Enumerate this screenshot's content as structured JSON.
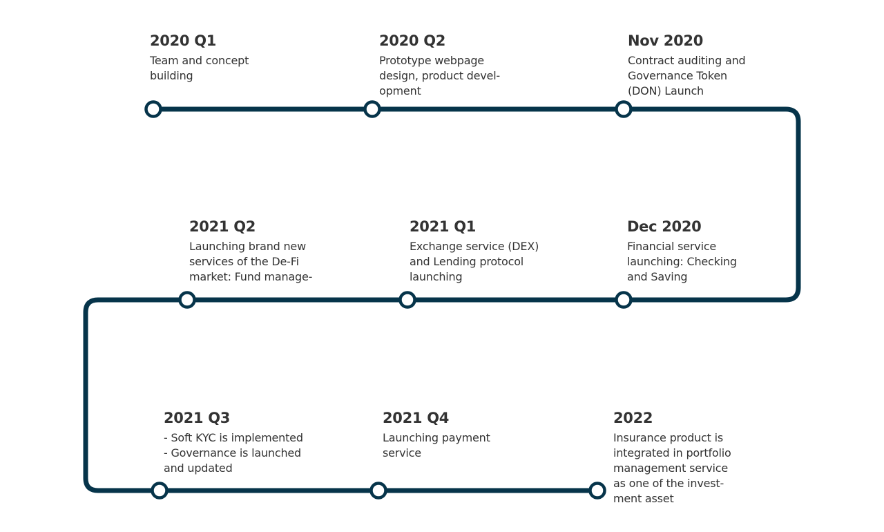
{
  "colors": {
    "track": "#06344a",
    "node_fill": "#ffffff",
    "text": "#333333"
  },
  "milestones": [
    {
      "title": "2020 Q1",
      "lines": [
        "Team and concept",
        "building"
      ]
    },
    {
      "title": "2020 Q2",
      "lines": [
        "Prototype webpage",
        "design, product devel-",
        "opment"
      ]
    },
    {
      "title": "Nov 2020",
      "lines": [
        "Contract auditing and",
        "Governance Token",
        "(DON) Launch"
      ]
    },
    {
      "title": "Dec 2020",
      "lines": [
        "Financial service",
        "launching: Checking",
        "and Saving"
      ]
    },
    {
      "title": "2021 Q1",
      "lines": [
        "Exchange service (DEX)",
        "and Lending protocol",
        "launching"
      ]
    },
    {
      "title": "2021 Q2",
      "lines": [
        "Launching brand new",
        "services of the De-Fi",
        "market: Fund manage-"
      ]
    },
    {
      "title": "2021 Q3",
      "lines": [
        "- Soft KYC is implemented",
        "- Governance is launched",
        "and updated"
      ]
    },
    {
      "title": "2021 Q4",
      "lines": [
        "Launching payment",
        "service"
      ]
    },
    {
      "title": "2022",
      "lines": [
        "Insurance product is",
        "integrated in portfolio",
        "management service",
        "as one of the invest-",
        "ment asset"
      ]
    }
  ]
}
